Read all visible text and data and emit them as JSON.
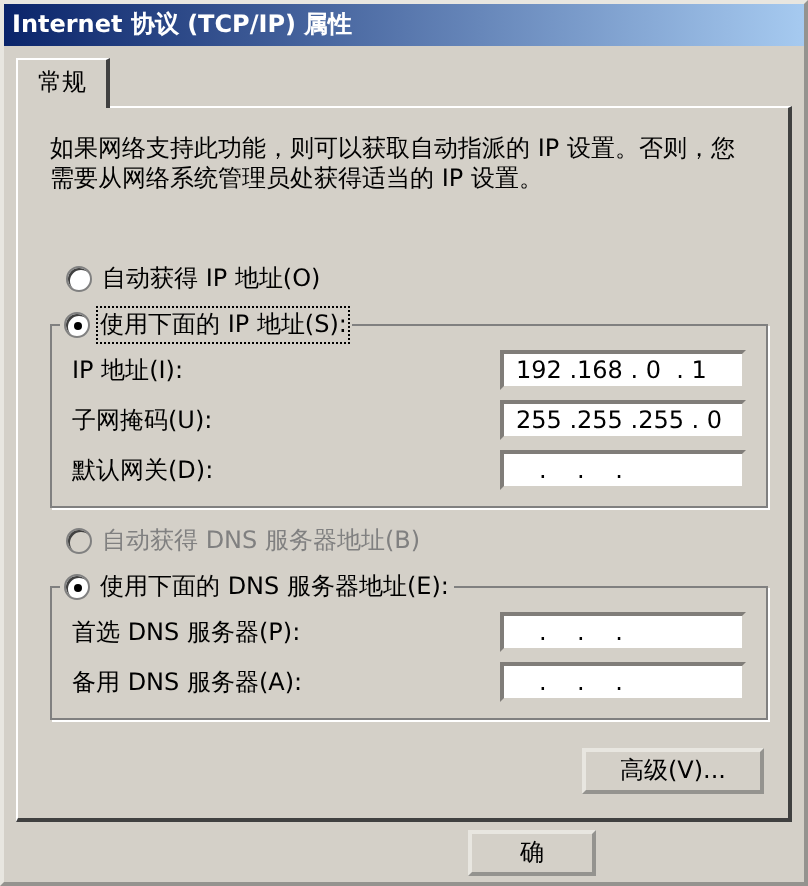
{
  "window": {
    "title": "Internet 协议 (TCP/IP) 属性"
  },
  "tabs": [
    {
      "label": "常规",
      "selected": true
    }
  ],
  "description": "如果网络支持此功能，则可以获取自动指派的 IP 设置。否则，您需要从网络系统管理员处获得适当的 IP 设置。",
  "ip_mode": [
    {
      "label": "自动获得 IP 地址(O)",
      "checked": false,
      "disabled": false,
      "focused": false
    },
    {
      "label": "使用下面的 IP 地址(S):",
      "checked": true,
      "disabled": false,
      "focused": true
    }
  ],
  "ip_fields": [
    {
      "label": "IP 地址(I):",
      "value": "192 .168 . 0  . 1"
    },
    {
      "label": "子网掩码(U):",
      "value": "255 .255 .255 . 0"
    },
    {
      "label": "默认网关(D):",
      "value": "   .    .    ."
    }
  ],
  "dns_mode": [
    {
      "label": "自动获得 DNS 服务器地址(B)",
      "checked": false,
      "disabled": true,
      "focused": false
    },
    {
      "label": "使用下面的 DNS 服务器地址(E):",
      "checked": true,
      "disabled": false,
      "focused": false
    }
  ],
  "dns_fields": [
    {
      "label": "首选 DNS 服务器(P):",
      "value": "   .    .    ."
    },
    {
      "label": "备用 DNS 服务器(A):",
      "value": "   .    .    ."
    }
  ],
  "advanced_button": "高级(V)...",
  "footer_buttons": [
    "确"
  ]
}
